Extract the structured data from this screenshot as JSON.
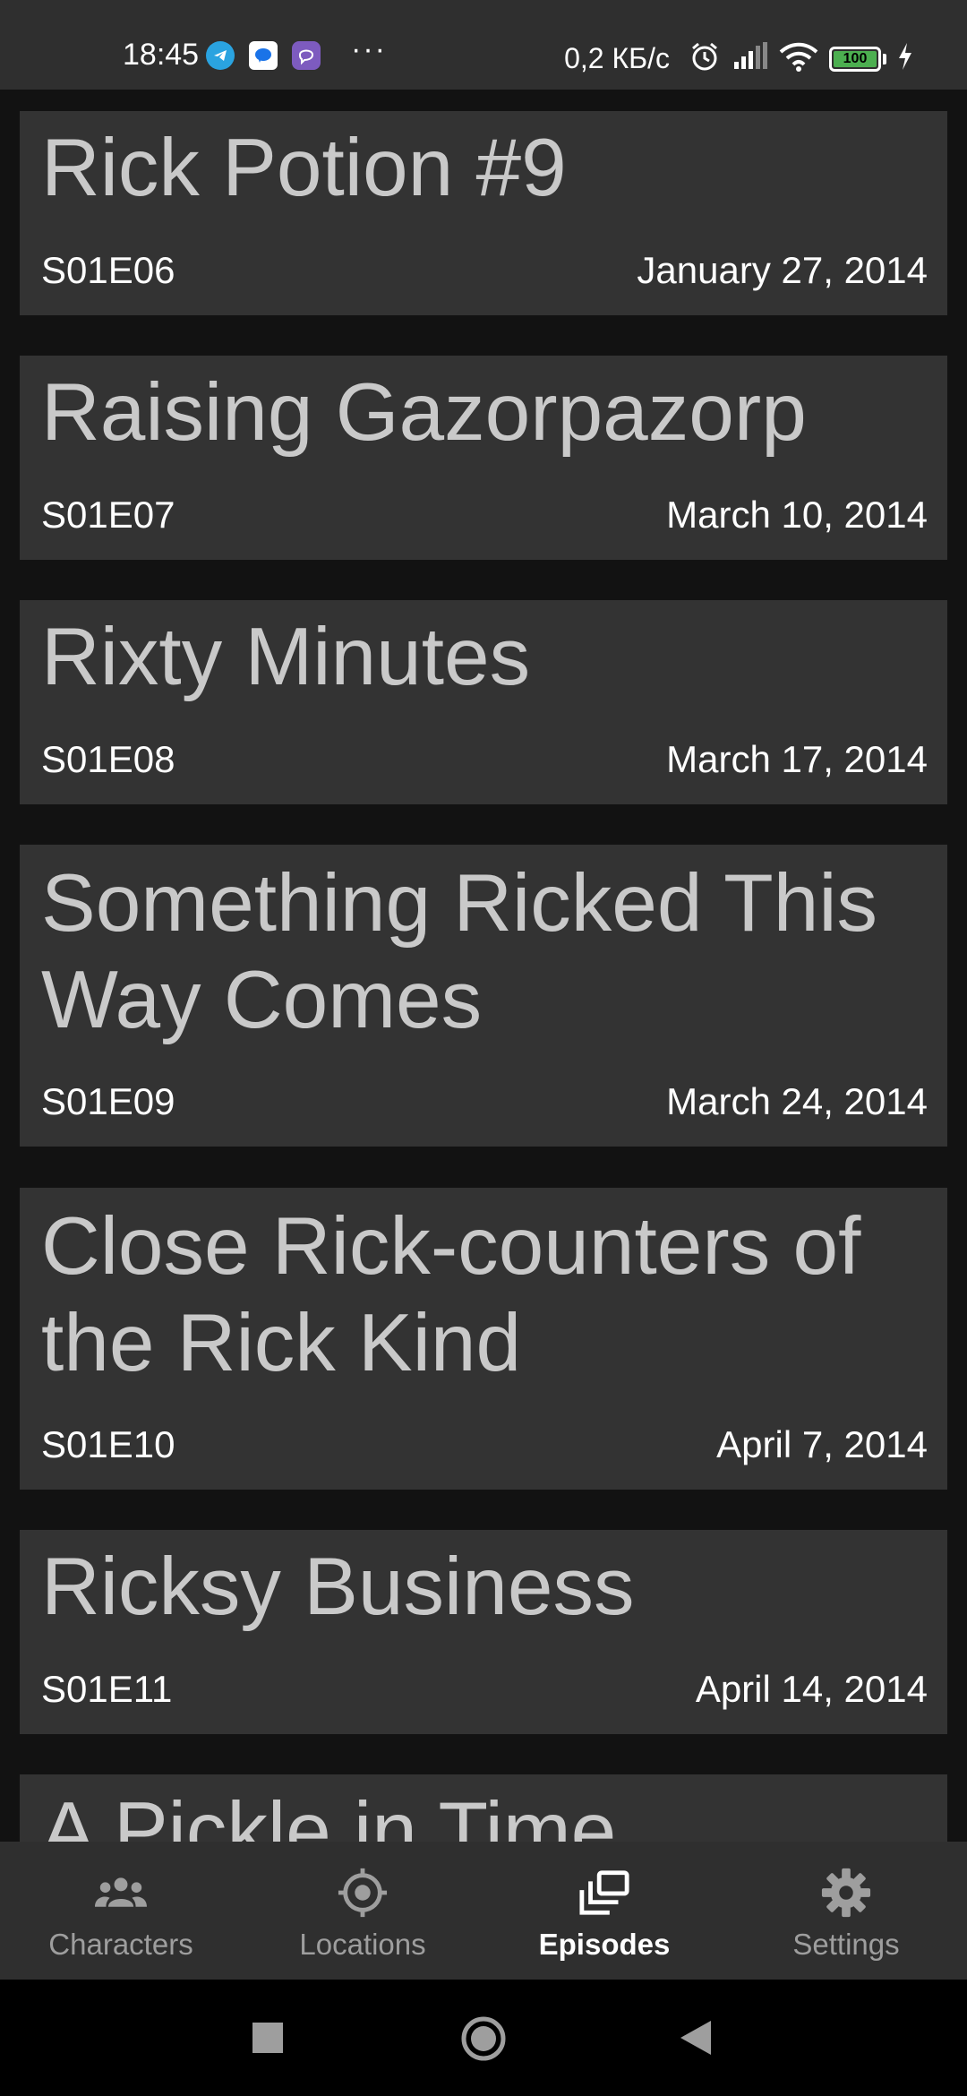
{
  "status_bar": {
    "time": "18:45",
    "notification_icons": [
      "telegram-icon",
      "messages-icon",
      "viber-icon"
    ],
    "more": "···",
    "network_speed": "0,2 КБ/с",
    "battery_level": "100"
  },
  "episodes": [
    {
      "title": "Rick Potion #9",
      "code": "S01E06",
      "air_date": "January 27, 2014"
    },
    {
      "title": "Raising Gazorpazorp",
      "code": "S01E07",
      "air_date": "March 10, 2014"
    },
    {
      "title": "Rixty Minutes",
      "code": "S01E08",
      "air_date": "March 17, 2014"
    },
    {
      "title": "Something Ricked This Way Comes",
      "code": "S01E09",
      "air_date": "March 24, 2014"
    },
    {
      "title": "Close Rick-counters of the Rick Kind",
      "code": "S01E10",
      "air_date": "April 7, 2014"
    },
    {
      "title": "Ricksy Business",
      "code": "S01E11",
      "air_date": "April 14, 2014"
    },
    {
      "title": "A Pickle in Time",
      "code": "",
      "air_date": ""
    }
  ],
  "bottom_nav": {
    "items": [
      {
        "label": "Characters",
        "icon": "people-icon",
        "active": false
      },
      {
        "label": "Locations",
        "icon": "location-target-icon",
        "active": false
      },
      {
        "label": "Episodes",
        "icon": "episodes-stack-icon",
        "active": true
      },
      {
        "label": "Settings",
        "icon": "gear-icon",
        "active": false
      }
    ]
  }
}
